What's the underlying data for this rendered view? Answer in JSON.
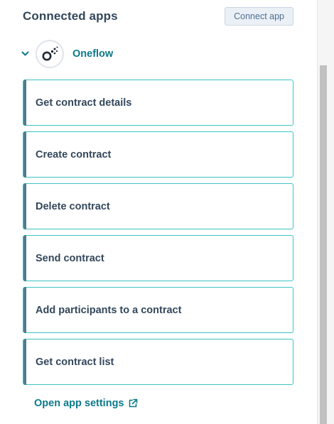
{
  "header": {
    "title": "Connected apps",
    "connect_label": "Connect app"
  },
  "app": {
    "name": "Oneflow",
    "expanded": true,
    "icons": {
      "chevron": "chevron-down-icon",
      "logo": "oneflow-logo-icon"
    }
  },
  "actions": [
    {
      "label": "Get contract details"
    },
    {
      "label": "Create contract"
    },
    {
      "label": "Delete contract"
    },
    {
      "label": "Send contract"
    },
    {
      "label": "Add participants to a contract"
    },
    {
      "label": "Get contract list"
    }
  ],
  "footer": {
    "settings_label": "Open app settings",
    "settings_icon": "external-link-icon"
  },
  "colors": {
    "accent": "#0b7a8a",
    "card_border": "#3fc3c5",
    "card_stripe": "#4d7c8e",
    "text": "#33475b"
  }
}
